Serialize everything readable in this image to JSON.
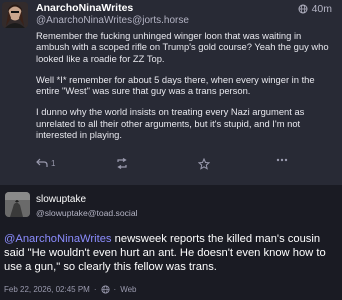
{
  "post_main": {
    "display_name": "AnarchoNinaWrites",
    "handle": "@AnarchoNinaWrites@jorts.horse",
    "age": "40m",
    "paragraphs": [
      "Remember the fucking unhinged winger loon that was waiting in ambush with a scoped rifle on Trump's gold course? Yeah the guy who looked like a roadie for ZZ Top.",
      "Well *I* remember for about 5 days there, when every winger in the entire \"West\" was sure that guy was a trans person.",
      "I dunno why the world insists on treating every Nazi argument as unrelated to all their other arguments, but it's stupid, and I'm not interested in playing."
    ],
    "reply_count": "1",
    "icons": [
      "globe-icon",
      "reply-icon",
      "boost-icon",
      "star-icon",
      "more-icon"
    ]
  },
  "post_reply": {
    "display_name": "slowuptake",
    "handle": "@slowuptake@toad.social",
    "mention": "@AnarchoNinaWrites",
    "text": " newsweek reports the killed man's cousin said \"He wouldn't even hurt an ant. He doesn't even know how to use a gun,\" so clearly this fellow was trans.",
    "date": "Feb 22, 2026, 02:45 PM",
    "separator": "·",
    "client": "Web",
    "icons": [
      "globe-icon"
    ]
  },
  "colors": {
    "page_bg": "#1a1b23",
    "post_bg": "#282a35",
    "mention": "#8c8dff",
    "muted": "#9a9aae"
  }
}
